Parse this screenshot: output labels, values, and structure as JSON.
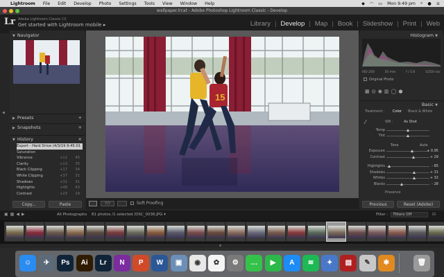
{
  "menubar": {
    "items": [
      "Lightroom",
      "File",
      "Edit",
      "Develop",
      "Photo",
      "Settings",
      "Tools",
      "View",
      "Window",
      "Help"
    ],
    "clock": "Mon 9:49 pm"
  },
  "window": {
    "title": "wallpaper.lrcat - Adobe Photoshop Lightroom Classic - Develop"
  },
  "identity": {
    "logo": "Lr",
    "subtitle": "Adobe Lightroom Classic CC",
    "main": "Get started with Lightroom mobile ▸"
  },
  "modules": [
    "Library",
    "Develop",
    "Map",
    "Book",
    "Slideshow",
    "Print",
    "Web"
  ],
  "left_panel": {
    "navigator": "Navigator",
    "presets": "Presets",
    "snapshots": "Snapshots",
    "history": "History",
    "history_items": [
      {
        "label": "Export - Hard Drive (4/3/19 9:45:01 pm)",
        "n1": "",
        "n2": ""
      },
      {
        "label": "Saturation",
        "n1": "",
        "n2": ""
      },
      {
        "label": "Vibrance",
        "n1": "+11",
        "n2": "45"
      },
      {
        "label": "Clarity",
        "n1": "+13",
        "n2": "35"
      },
      {
        "label": "Black Clipping",
        "n1": "+17",
        "n2": "34"
      },
      {
        "label": "White Clipping",
        "n1": "+37",
        "n2": "31"
      },
      {
        "label": "Shadows",
        "n1": "+31",
        "n2": "31"
      },
      {
        "label": "Highlights",
        "n1": "+48",
        "n2": "43"
      },
      {
        "label": "Contrast",
        "n1": "+23",
        "n2": "29"
      }
    ],
    "copy_label": "Copy...",
    "paste_label": "Paste"
  },
  "toolbar": {
    "soft_proofing": "Soft Proofing"
  },
  "right_panel": {
    "histogram": "Histogram",
    "iso": "ISO 250",
    "focal": "35 mm",
    "aperture": "f / 5.6",
    "shutter": "1/250 sec",
    "original_photo": "Original Photo",
    "basic": "Basic",
    "treatment_label": "Treatment :",
    "treatment_color": "Color",
    "treatment_bw": "Black & White",
    "wb_label": "WB :",
    "wb_value": "As Shot",
    "tone_label": "Tone",
    "auto_label": "Auto",
    "presence_label": "Presence",
    "sliders_wb": [
      {
        "label": "Temp",
        "value": "",
        "pos": 0.5
      },
      {
        "label": "Tint",
        "value": "",
        "pos": 0.5
      }
    ],
    "sliders_tone": [
      {
        "label": "Exposure",
        "value": "+ 0.95",
        "pos": 0.6
      },
      {
        "label": "Contrast",
        "value": "+ 29",
        "pos": 0.64
      }
    ],
    "sliders_hs": [
      {
        "label": "Highlights",
        "value": "- 85",
        "pos": 0.08
      },
      {
        "label": "Shadows",
        "value": "+ 31",
        "pos": 0.65
      },
      {
        "label": "Whites",
        "value": "+ 32",
        "pos": 0.66
      },
      {
        "label": "Blacks",
        "value": "- 28",
        "pos": 0.36
      }
    ],
    "previous_label": "Previous",
    "reset_label": "Reset (Adobe)"
  },
  "filmstrip": {
    "source": "All Photographs",
    "count": "81 photos /1 selected /DSC_0036.JPG ▾",
    "filter_label": "Filter :",
    "filter_value": "Filters Off"
  },
  "dock": {
    "apps": [
      {
        "name": "finder",
        "label": "☺",
        "color": "#2a8cf0"
      },
      {
        "name": "launchpad",
        "label": "✈",
        "color": "#5d6a78"
      },
      {
        "name": "photoshop",
        "label": "Ps",
        "color": "#0f2438"
      },
      {
        "name": "illustrator",
        "label": "Ai",
        "color": "#2f1c00"
      },
      {
        "name": "lightroom",
        "label": "Lr",
        "color": "#0f2438"
      },
      {
        "name": "onenote",
        "label": "N",
        "color": "#7b2c9e"
      },
      {
        "name": "powerpoint",
        "label": "P",
        "color": "#d04a2a"
      },
      {
        "name": "word",
        "label": "W",
        "color": "#2b5797"
      },
      {
        "name": "preview",
        "label": "▣",
        "color": "#6c8fb8"
      },
      {
        "name": "chrome",
        "label": "◉",
        "color": "#e8e8e8"
      },
      {
        "name": "photos",
        "label": "✿",
        "color": "#f4f4f4"
      },
      {
        "name": "system-preferences",
        "label": "⚙",
        "color": "#7a7a7a"
      },
      {
        "name": "messages",
        "label": "…",
        "color": "#35c24a"
      },
      {
        "name": "facetime",
        "label": "▶",
        "color": "#2db84a"
      },
      {
        "name": "app-store",
        "label": "A",
        "color": "#1d8cf5"
      },
      {
        "name": "spotify",
        "label": "≋",
        "color": "#1db954"
      },
      {
        "name": "iphoto",
        "label": "✦",
        "color": "#4a78c8"
      },
      {
        "name": "photo-booth",
        "label": "▤",
        "color": "#b02020"
      },
      {
        "name": "preview-file",
        "label": "✎",
        "color": "#c8c8c8"
      },
      {
        "name": "notes",
        "label": "✱",
        "color": "#e08a20"
      },
      {
        "name": "trash",
        "label": "🗑",
        "color": "#9a9a9a"
      }
    ]
  },
  "colors": {
    "accent": "#d6d6d6",
    "panel": "#292929",
    "photo_curtain": "#8a1e34",
    "jersey_yellow": "#e6b52a",
    "jersey_red": "#a8242e"
  }
}
